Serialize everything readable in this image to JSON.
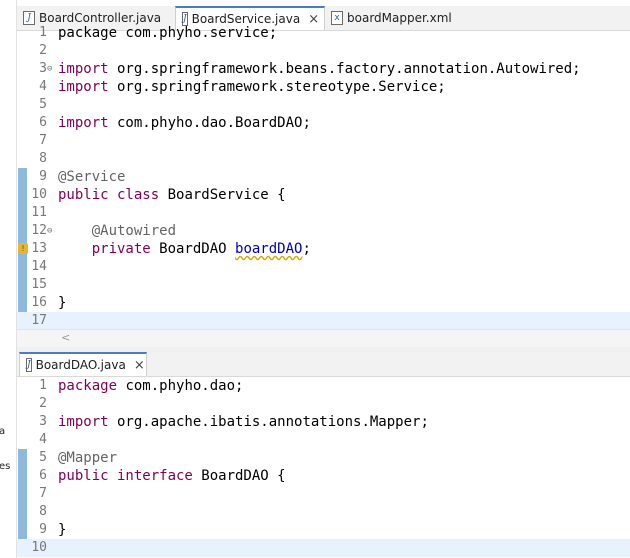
{
  "left_strip": {
    "fragments": [
      "a",
      "es"
    ]
  },
  "top_pane": {
    "tabs": [
      {
        "label": "BoardController.java",
        "icon": "java-file-icon",
        "active": false
      },
      {
        "label": "BoardService.java",
        "icon": "java-file-icon",
        "active": true,
        "closable": true
      },
      {
        "label": "boardMapper.xml",
        "icon": "xml-file-icon",
        "active": false
      }
    ],
    "close_glyph": "×",
    "lines": [
      {
        "n": "1",
        "text": "package com.phyho.service;"
      },
      {
        "n": "2",
        "text": ""
      },
      {
        "n": "3",
        "kw": "import",
        "rest": " org.springframework.beans.factory.annotation.Autowired;",
        "fold": "⊖"
      },
      {
        "n": "4",
        "kw": "import",
        "rest": " org.springframework.stereotype.Service;"
      },
      {
        "n": "5",
        "text": ""
      },
      {
        "n": "6",
        "kw": "import",
        "rest": " com.phyho.dao.BoardDAO;"
      },
      {
        "n": "7",
        "text": ""
      },
      {
        "n": "8",
        "text": ""
      },
      {
        "n": "9",
        "ann": "@Service"
      },
      {
        "n": "10",
        "kw": "public class",
        "rest": " BoardService {"
      },
      {
        "n": "11",
        "text": ""
      },
      {
        "n": "12",
        "ann": "    @Autowired",
        "fold": "⊖"
      },
      {
        "n": "13",
        "kw": "    private",
        "rest": " BoardDAO ",
        "field": "boardDAO",
        "tail": ";"
      },
      {
        "n": "14",
        "text": ""
      },
      {
        "n": "15",
        "text": ""
      },
      {
        "n": "16",
        "text": "}"
      },
      {
        "n": "17",
        "text": ""
      }
    ],
    "scroll_arrow": "<"
  },
  "bottom_pane": {
    "tab": {
      "label": "BoardDAO.java",
      "icon": "java-file-icon"
    },
    "close_glyph": "×",
    "lines": [
      {
        "n": "1",
        "kw": "package",
        "rest": " com.phyho.dao;"
      },
      {
        "n": "2",
        "text": ""
      },
      {
        "n": "3",
        "kw": "import",
        "rest": " org.apache.ibatis.annotations.Mapper;"
      },
      {
        "n": "4",
        "text": ""
      },
      {
        "n": "5",
        "ann": "@Mapper"
      },
      {
        "n": "6",
        "kw": "public interface",
        "rest": " BoardDAO {"
      },
      {
        "n": "7",
        "text": ""
      },
      {
        "n": "8",
        "text": ""
      },
      {
        "n": "9",
        "text": "}"
      },
      {
        "n": "10",
        "text": ""
      }
    ]
  },
  "colors": {
    "keyword": "#7f0055",
    "annotation": "#646464",
    "field": "#0000c0",
    "change_marker": "#8fb8de",
    "current_line": "#e8f2fe"
  }
}
